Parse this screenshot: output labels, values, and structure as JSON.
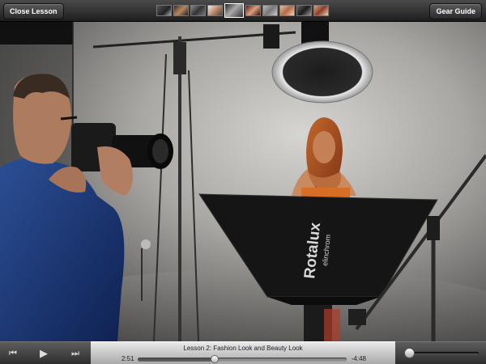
{
  "topbar": {
    "close_label": "Close Lesson",
    "gear_label": "Gear Guide",
    "thumbnails": [
      {
        "selected": false
      },
      {
        "selected": false
      },
      {
        "selected": false
      },
      {
        "selected": false
      },
      {
        "selected": true
      },
      {
        "selected": false
      },
      {
        "selected": false
      },
      {
        "selected": false
      },
      {
        "selected": false
      },
      {
        "selected": false
      }
    ]
  },
  "photo": {
    "softbox_brand": "Rotalux",
    "softbox_maker": "elinchrom"
  },
  "player": {
    "title": "Lesson 2: Fashion Look and Beauty Look",
    "elapsed": "2:51",
    "remaining": "-4:48",
    "progress_fraction": 0.37,
    "volume_fraction": 0.0,
    "icons": {
      "prev": "skip-back-icon",
      "play": "play-icon",
      "next": "skip-forward-icon"
    }
  }
}
